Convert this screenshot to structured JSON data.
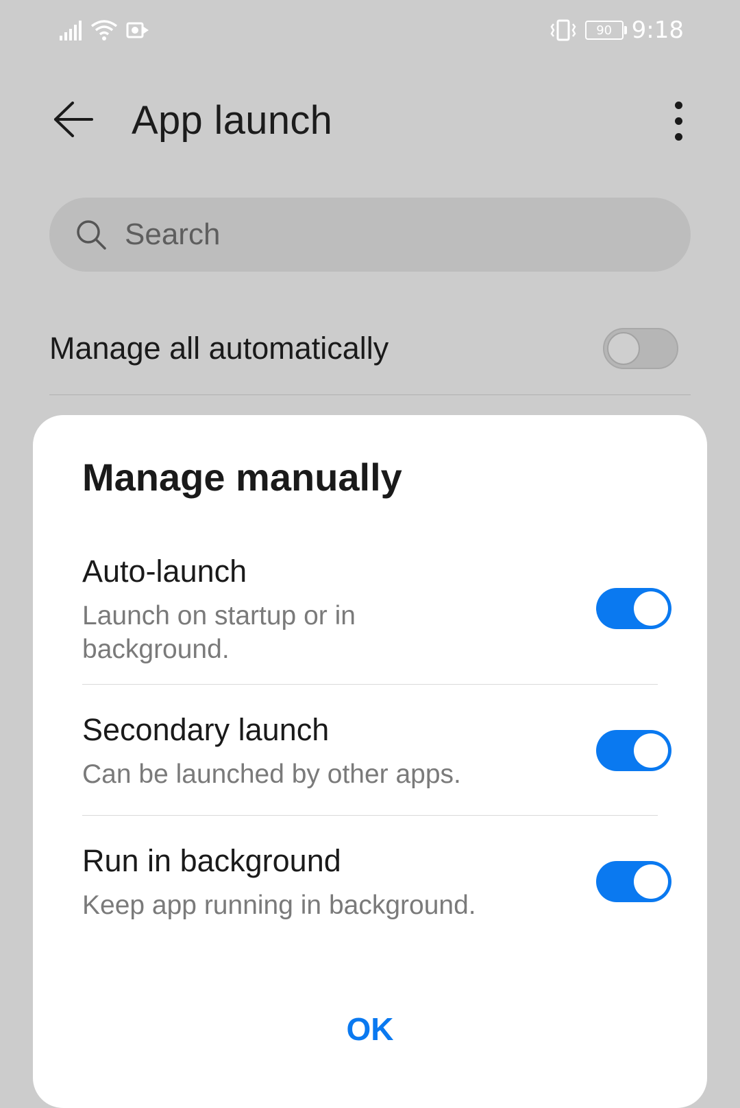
{
  "status_bar": {
    "time": "9:18",
    "battery_level": "90",
    "icons": [
      "signal-icon",
      "wifi-icon",
      "notification-icon",
      "vibrate-icon",
      "battery-icon"
    ]
  },
  "header": {
    "title": "App launch"
  },
  "search": {
    "placeholder": "Search"
  },
  "manage_all": {
    "label": "Manage all automatically",
    "enabled": false
  },
  "dialog": {
    "title": "Manage manually",
    "options": [
      {
        "title": "Auto-launch",
        "subtitle": "Launch on startup or in background.",
        "enabled": true
      },
      {
        "title": "Secondary launch",
        "subtitle": "Can be launched by other apps.",
        "enabled": true
      },
      {
        "title": "Run in background",
        "subtitle": "Keep app running in background.",
        "enabled": true
      }
    ],
    "ok_label": "OK"
  },
  "colors": {
    "accent": "#0a79f0",
    "backdrop": "#cccccc",
    "dialog_bg": "#ffffff"
  }
}
